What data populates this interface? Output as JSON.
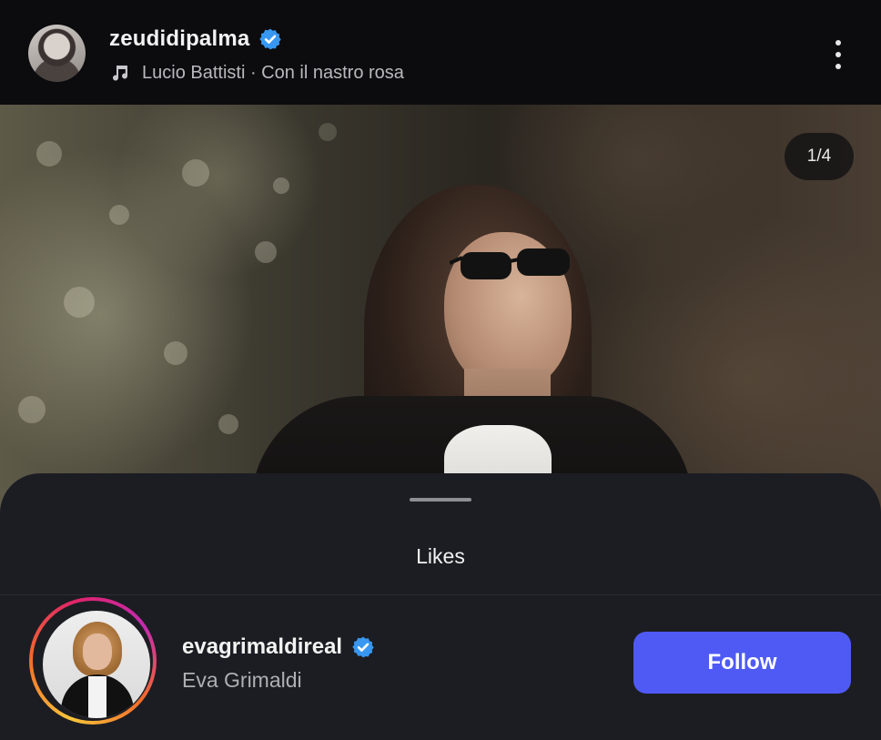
{
  "header": {
    "username": "zeudidipalma",
    "verified": true,
    "music_text": "Lucio Battisti · Con il nastro rosa",
    "icons": {
      "avatar": "profile-avatar",
      "verified": "verified-badge-icon",
      "music": "music-note-icon",
      "more": "more-vertical-icon"
    }
  },
  "photo": {
    "page_counter": "1/4"
  },
  "likes_sheet": {
    "title": "Likes",
    "users": [
      {
        "username": "evagrimaldireal",
        "full_name": "Eva Grimaldi",
        "verified": true,
        "has_story": true,
        "follow_label": "Follow"
      }
    ]
  },
  "colors": {
    "verified_blue": "#3897f0",
    "follow_button": "#4f5af5",
    "sheet_background": "#1c1d22"
  }
}
